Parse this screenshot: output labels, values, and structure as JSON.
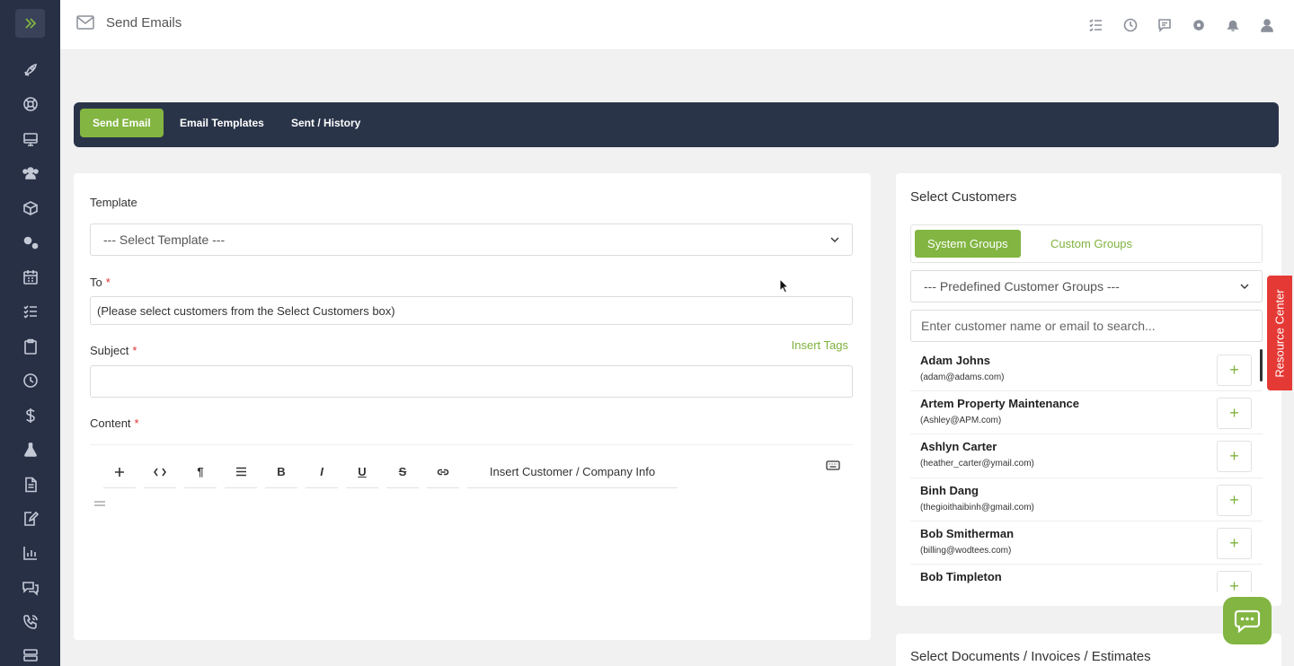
{
  "header": {
    "title": "Send Emails"
  },
  "tabs": [
    {
      "label": "Send Email",
      "active": true
    },
    {
      "label": "Email Templates",
      "active": false
    },
    {
      "label": "Sent / History",
      "active": false
    }
  ],
  "form": {
    "template_label": "Template",
    "template_value": "--- Select Template ---",
    "to_label": "To",
    "to_value": "(Please select customers from the Select Customers box)",
    "subject_label": "Subject",
    "subject_value": "",
    "insert_tags": "Insert Tags",
    "content_label": "Content",
    "required_mark": "*",
    "toolbar": {
      "bold": "B",
      "italic": "I",
      "underline": "U",
      "strike": "S",
      "paragraph": "¶",
      "insert_info": "Insert Customer / Company Info"
    }
  },
  "customers": {
    "title": "Select Customers",
    "group_tabs": [
      {
        "label": "System Groups",
        "active": true
      },
      {
        "label": "Custom Groups",
        "active": false
      }
    ],
    "group_select": "--- Predefined Customer Groups ---",
    "search_placeholder": "Enter customer name or email to search...",
    "list": [
      {
        "name": "Adam Johns",
        "email": "(adam@adams.com)"
      },
      {
        "name": "Artem Property Maintenance",
        "email": "(Ashley@APM.com)"
      },
      {
        "name": "Ashlyn Carter",
        "email": "(heather_carter@ymail.com)"
      },
      {
        "name": "Binh Dang",
        "email": "(thegioithaibinh@gmail.com)"
      },
      {
        "name": "Bob Smitherman",
        "email": "(billing@wodtees.com)"
      },
      {
        "name": "Bob Timpleton",
        "email": ""
      }
    ],
    "add_symbol": "+"
  },
  "documents": {
    "title": "Select Documents / Invoices / Estimates"
  },
  "resource_center": "Resource Center",
  "colors": {
    "accent": "#82b541",
    "sidebar": "#283046",
    "tabs_bar": "#2a3449",
    "resource": "#e53935"
  }
}
